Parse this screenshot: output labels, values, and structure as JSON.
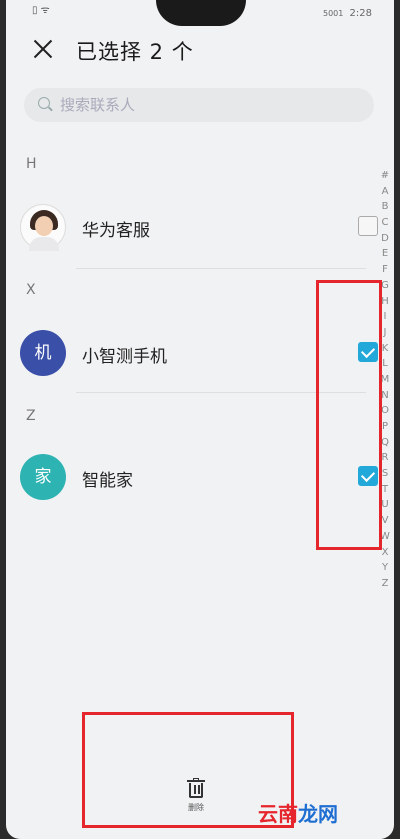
{
  "status": {
    "left": "▯ ᯤ",
    "network": "5001",
    "time": "2:28"
  },
  "header": {
    "title": "已选择 2 个"
  },
  "search": {
    "placeholder": "搜索联系人"
  },
  "sections": [
    {
      "letter": "H",
      "contacts": [
        {
          "name": "华为客服",
          "avatar": "photo",
          "checked": false
        }
      ]
    },
    {
      "letter": "X",
      "contacts": [
        {
          "name": "小智测手机",
          "avatar_text": "机",
          "avatar_color": "#3a4fa8",
          "checked": true
        }
      ]
    },
    {
      "letter": "Z",
      "contacts": [
        {
          "name": "智能家",
          "avatar_text": "家",
          "avatar_color": "#2eb3b3",
          "checked": true
        }
      ]
    }
  ],
  "alpha_index": [
    "#",
    "A",
    "B",
    "C",
    "D",
    "E",
    "F",
    "G",
    "H",
    "I",
    "J",
    "K",
    "L",
    "M",
    "N",
    "O",
    "P",
    "Q",
    "R",
    "S",
    "T",
    "U",
    "V",
    "W",
    "X",
    "Y",
    "Z"
  ],
  "footer": {
    "delete_label": "删除"
  },
  "colors": {
    "accent": "#23a9d9",
    "highlight": "#e6262d"
  },
  "watermark": {
    "part1": "云南",
    "part2": "龙网"
  }
}
